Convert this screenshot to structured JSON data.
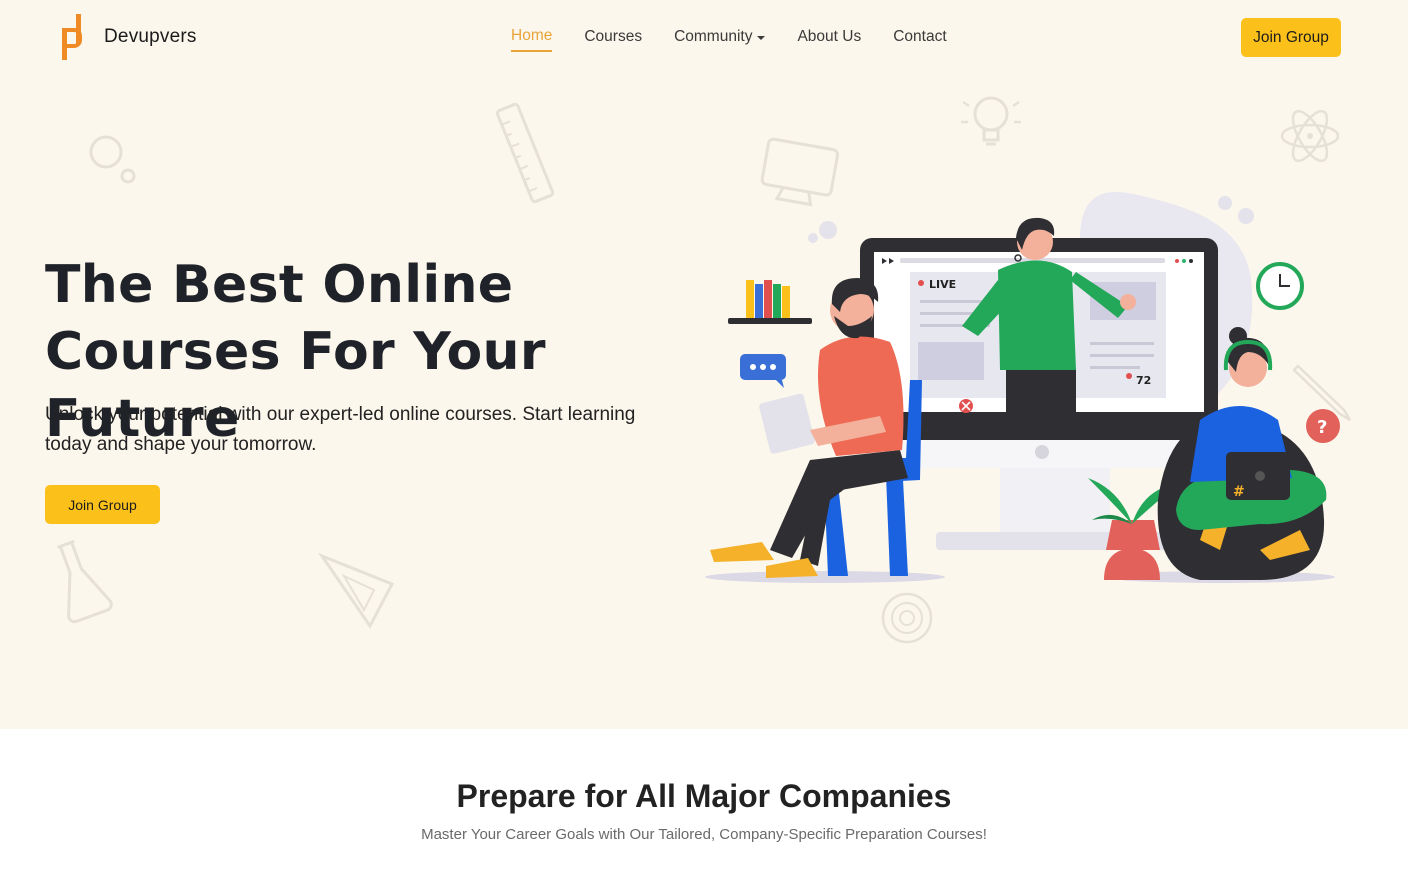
{
  "brand": {
    "name": "Devupvers",
    "logo_icon": "devupvers-logo-icon",
    "accent_color": "#f08a24"
  },
  "nav": {
    "items": [
      {
        "label": "Home",
        "active": true
      },
      {
        "label": "Courses",
        "active": false
      },
      {
        "label": "Community",
        "active": false,
        "dropdown": true
      },
      {
        "label": "About Us",
        "active": false
      },
      {
        "label": "Contact",
        "active": false
      }
    ],
    "active_color": "#e9a43a"
  },
  "header": {
    "join_label": "Join Group"
  },
  "hero": {
    "title_line1": "The Best Online",
    "title_line2": "Courses For Your Future",
    "description": "Unlock your potential with our expert-led online courses. Start learning today and shape your tomorrow.",
    "join_label": "Join Group",
    "background": "#fcf7ec",
    "button_color": "#fbc11a",
    "illustration": {
      "live_label": "LIVE",
      "viewer_count": "72",
      "badge_hash": "#",
      "badge_question": "?"
    }
  },
  "section": {
    "title": "Prepare for All Major Companies",
    "subtitle": "Master Your Career Goals with Our Tailored, Company-Specific Preparation Courses!"
  }
}
